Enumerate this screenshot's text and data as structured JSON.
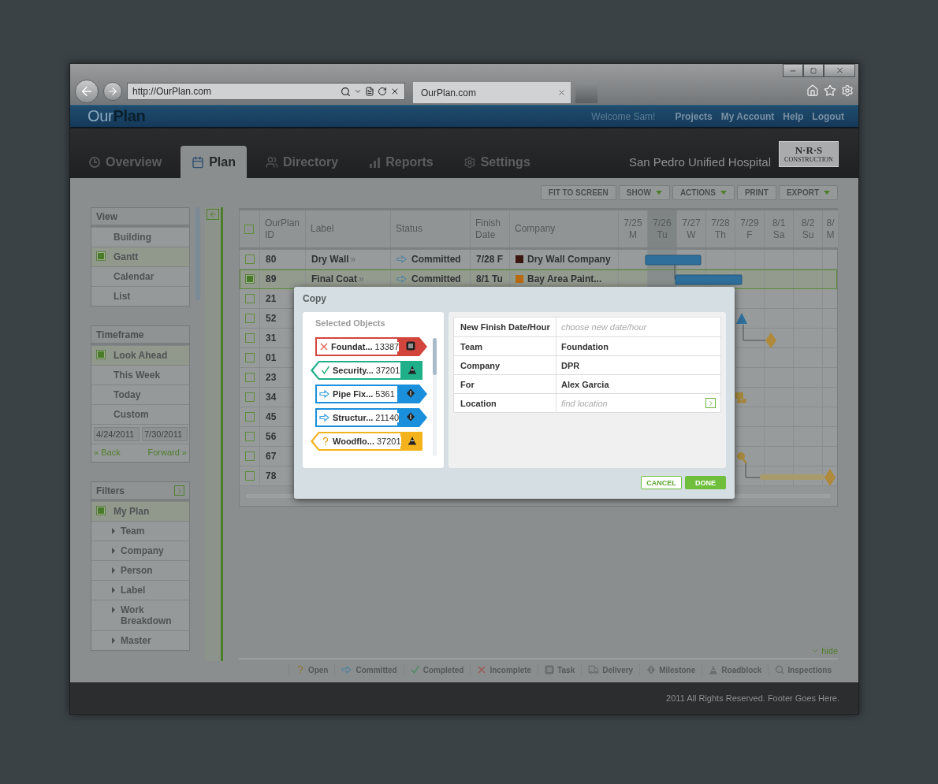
{
  "browser": {
    "url": "http://OurPlan.com",
    "tab": "OurPlan.com"
  },
  "header": {
    "logo": "Our**Plan**",
    "welcome": "Welcome Sam!",
    "links": [
      "Projects",
      "My Account",
      "Help",
      "Logout"
    ]
  },
  "nav": {
    "tabs": [
      {
        "label": "Overview",
        "selected": false
      },
      {
        "label": "Plan",
        "selected": true
      },
      {
        "label": "Directory",
        "selected": false
      },
      {
        "label": "Reports",
        "selected": false
      },
      {
        "label": "Settings",
        "selected": false
      }
    ],
    "project": "San Pedro Unified Hospital",
    "brand": {
      "name": "N·R·S",
      "sub": "CONSTRUCTION"
    }
  },
  "sidebar": {
    "view": {
      "title": "View",
      "items": [
        {
          "label": "Building",
          "selected": false
        },
        {
          "label": "Gantt",
          "selected": true
        },
        {
          "label": "Calendar",
          "selected": false
        },
        {
          "label": "List",
          "selected": false
        }
      ]
    },
    "timeframe": {
      "title": "Timeframe",
      "items": [
        {
          "label": "Look Ahead",
          "selected": true
        },
        {
          "label": "This Week",
          "selected": false
        },
        {
          "label": "Today",
          "selected": false
        },
        {
          "label": "Custom",
          "selected": false
        }
      ],
      "dates": [
        "4/24/2011",
        "7/30/2011"
      ],
      "back": "« Back",
      "forward": "Forward »"
    },
    "filters": {
      "title": "Filters",
      "items": [
        {
          "label": "My Plan",
          "kind": "check",
          "selected": true
        },
        {
          "label": "Team",
          "kind": "group",
          "expanded": false
        },
        {
          "label": "Company",
          "kind": "group",
          "expanded": false
        },
        {
          "label": "Person",
          "kind": "group",
          "expanded": false
        },
        {
          "label": "Label",
          "kind": "group",
          "expanded": false
        },
        {
          "label": "Work Breakdown",
          "kind": "group",
          "expanded": false
        },
        {
          "label": "Master",
          "kind": "group",
          "expanded": false
        }
      ]
    }
  },
  "toolbar": [
    {
      "label": "FIT TO SCREEN",
      "dropdown": false
    },
    {
      "label": "SHOW",
      "dropdown": true
    },
    {
      "label": "ACTIONS",
      "dropdown": true
    },
    {
      "label": "PRINT",
      "dropdown": false
    },
    {
      "label": "EXPORT",
      "dropdown": true
    }
  ],
  "table": {
    "select_all": {
      "checked": false
    },
    "columns": [
      "OurPlan ID",
      "Label",
      "Status",
      "Finish Date",
      "Company"
    ],
    "days": [
      {
        "date": "7/25",
        "day": "M",
        "highlighted": false
      },
      {
        "date": "7/26",
        "day": "Tu",
        "highlighted": true
      },
      {
        "date": "7/27",
        "day": "W",
        "highlighted": false
      },
      {
        "date": "7/28",
        "day": "Th",
        "highlighted": false
      },
      {
        "date": "7/29",
        "day": "F",
        "highlighted": false
      },
      {
        "date": "8/1",
        "day": "Sa",
        "highlighted": false
      },
      {
        "date": "8/2",
        "day": "Su",
        "highlighted": false
      },
      {
        "date": "8/",
        "day": "M",
        "highlighted": false
      }
    ],
    "rows": [
      {
        "id": "80",
        "label": "Dry Wall",
        "more": "»",
        "status": "Committed",
        "finish": "7/28 F",
        "company": "Dry Wall Company",
        "color": "#3b1512",
        "selected": false
      },
      {
        "id": "89",
        "label": "Final Coat",
        "more": "»",
        "status": "Committed",
        "finish": "8/1 Tu",
        "company": "Bay Area Paint...",
        "color": "#b86a10",
        "selected": true
      },
      {
        "id": "21",
        "selected": false
      },
      {
        "id": "52",
        "selected": false
      },
      {
        "id": "31",
        "selected": false
      },
      {
        "id": "01",
        "selected": false
      },
      {
        "id": "23",
        "selected": false
      },
      {
        "id": "34",
        "selected": false
      },
      {
        "id": "45",
        "selected": false
      },
      {
        "id": "56",
        "selected": false
      },
      {
        "id": "67",
        "selected": false
      },
      {
        "id": "78",
        "selected": false
      }
    ]
  },
  "hide": "hide",
  "legend": [
    {
      "label": "Open",
      "kind": "open"
    },
    {
      "label": "Committed",
      "kind": "committed"
    },
    {
      "label": "Completed",
      "kind": "completed"
    },
    {
      "label": "Incomplete",
      "kind": "incomplete"
    },
    {
      "label": "Task",
      "kind": "task"
    },
    {
      "label": "Delivery",
      "kind": "delivery"
    },
    {
      "label": "Milestone",
      "kind": "milestone"
    },
    {
      "label": "Roadblock",
      "kind": "roadblock"
    },
    {
      "label": "Inspections",
      "kind": "inspection"
    }
  ],
  "footer": "2011 All Rights Reserved. Footer Goes Here.",
  "dialog": {
    "title": "Copy",
    "objects_heading": "Selected Objects",
    "objects": [
      {
        "name": "Foundat...",
        "number": "13387",
        "status": {
          "kind": "incomplete"
        },
        "type": {
          "kind": "task"
        },
        "color": "#d2453c"
      },
      {
        "name": "Security...",
        "number": "37201",
        "status": {
          "kind": "completed"
        },
        "type": {
          "kind": "roadblock"
        },
        "color": "#1fb08a"
      },
      {
        "name": "Pipe Fix...",
        "number": "5361",
        "status": {
          "kind": "committed"
        },
        "type": {
          "kind": "milestone"
        },
        "color": "#1a8fdb"
      },
      {
        "name": "Structur...",
        "number": "21140",
        "status": {
          "kind": "committed"
        },
        "type": {
          "kind": "milestone"
        },
        "color": "#1a8fdb"
      },
      {
        "name": "Woodflo...",
        "number": "37201",
        "status": {
          "kind": "open"
        },
        "type": {
          "kind": "roadblock"
        },
        "color": "#f4b21d"
      }
    ],
    "fields": [
      {
        "label": "New Finish Date/Hour",
        "placeholder": "choose new date/hour"
      },
      {
        "label": "Team",
        "value": "Foundation"
      },
      {
        "label": "Company",
        "value": "DPR"
      },
      {
        "label": "For",
        "value": "Alex Garcia"
      },
      {
        "label": "Location",
        "placeholder": "find location",
        "action": true
      }
    ],
    "buttons": [
      {
        "label": "CANCEL",
        "kind": "secondary"
      },
      {
        "label": "DONE",
        "kind": "primary"
      }
    ]
  }
}
